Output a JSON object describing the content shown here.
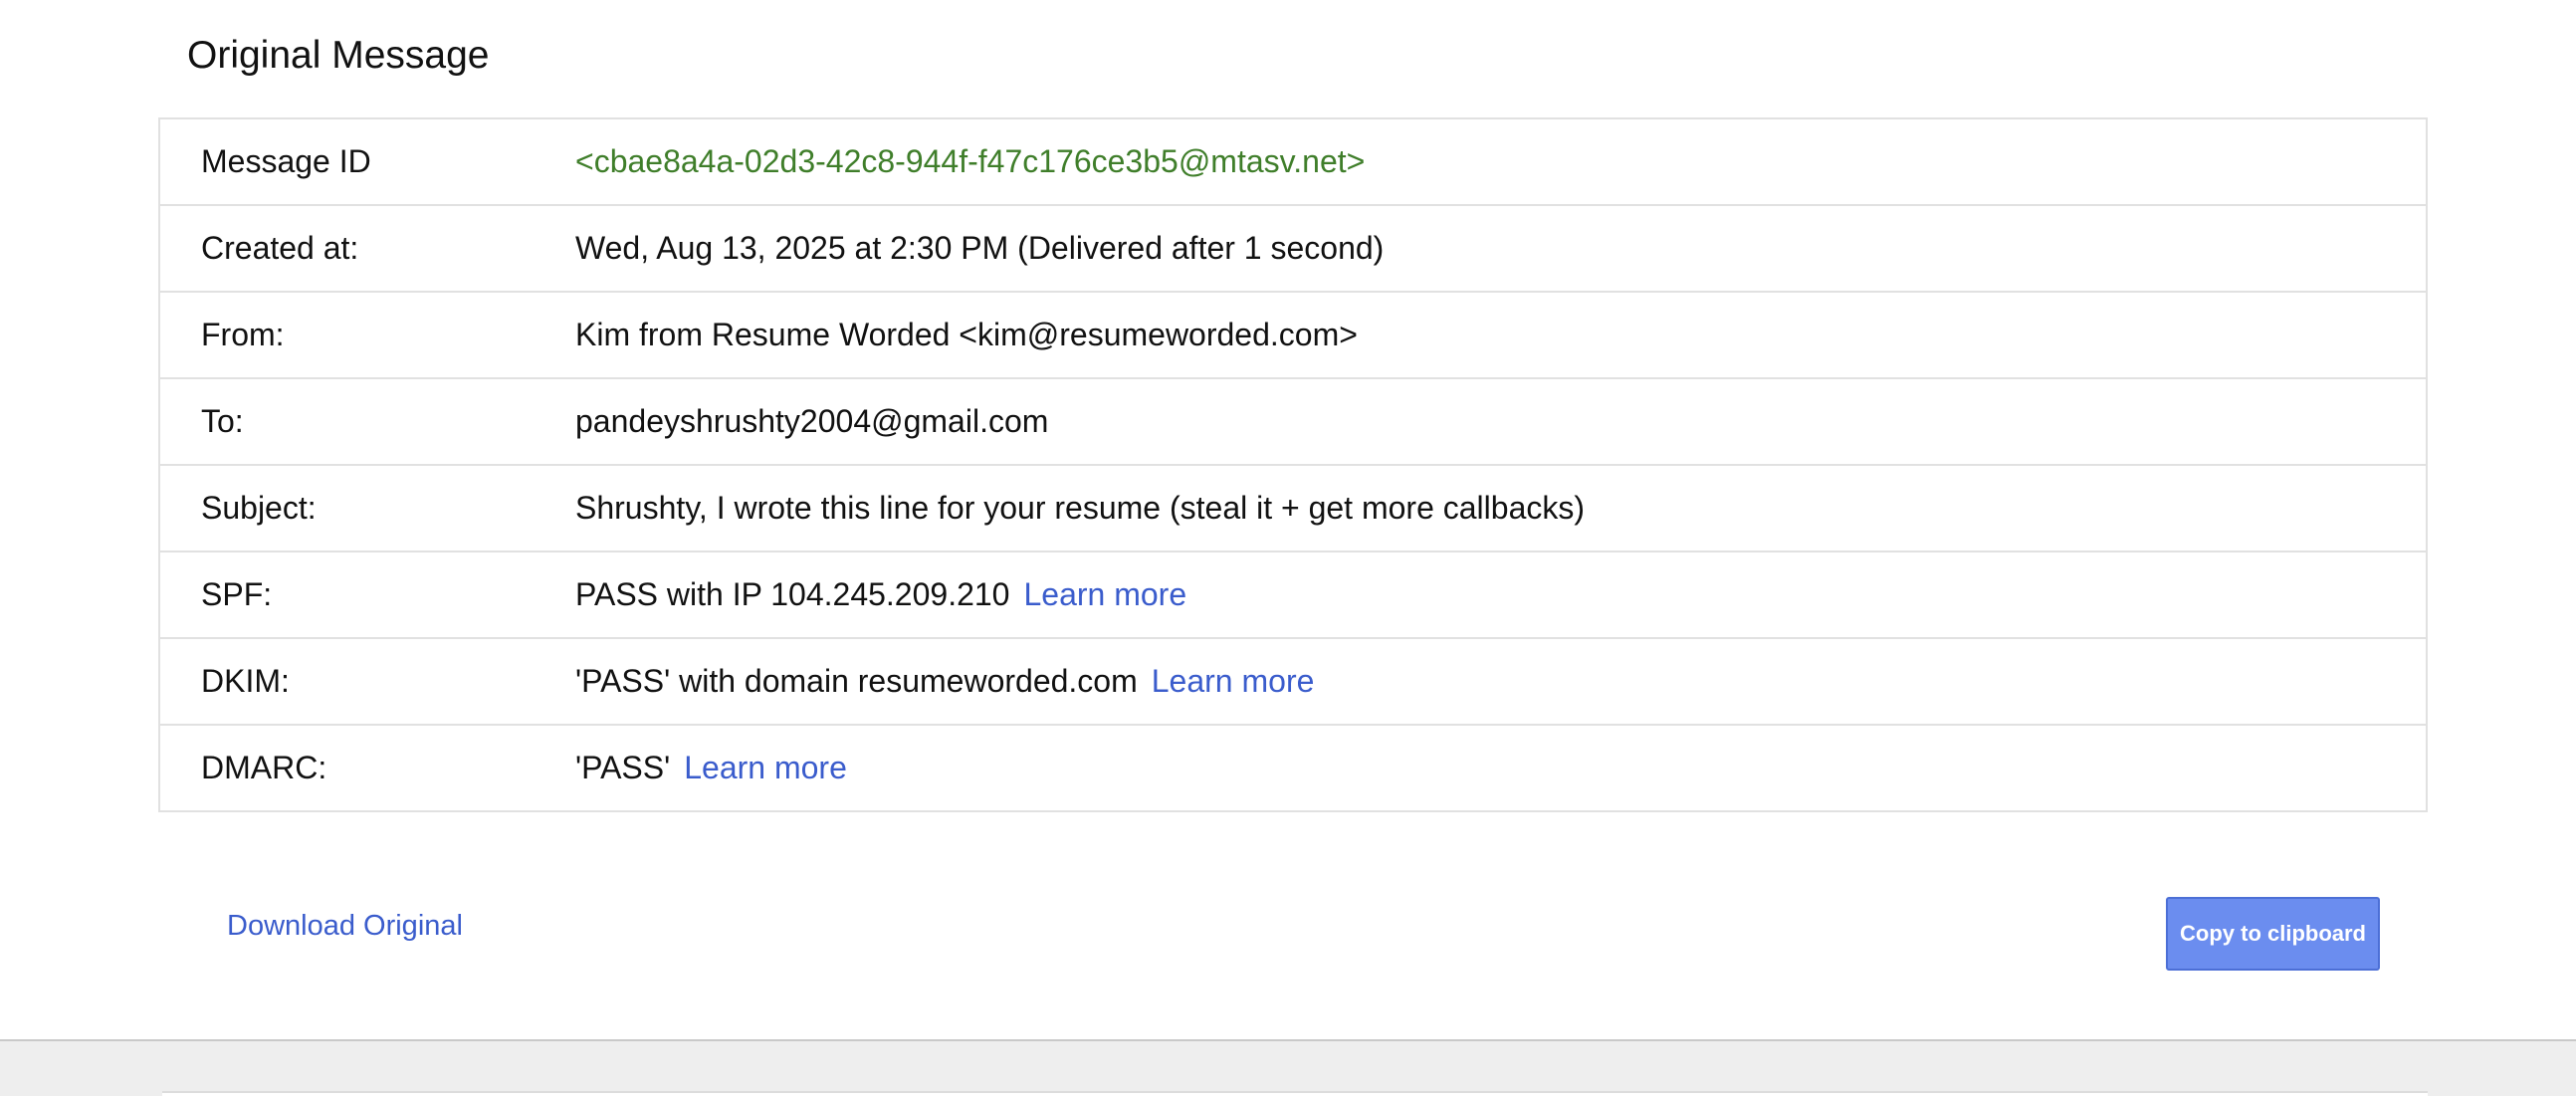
{
  "page": {
    "title": "Original Message"
  },
  "rows": [
    {
      "label": "Message ID",
      "value": "<cbae8a4a-02d3-42c8-944f-f47c176ce3b5@mtasv.net>"
    },
    {
      "label": "Created at:",
      "value": "Wed, Aug 13, 2025 at 2:30 PM (Delivered after 1 second)"
    },
    {
      "label": "From:",
      "value": "Kim from Resume Worded <kim@resumeworded.com>"
    },
    {
      "label": "To:",
      "value": "pandeyshrushty2004@gmail.com"
    },
    {
      "label": "Subject:",
      "value": "Shrushty, I wrote this line for your resume (steal it + get more callbacks)"
    },
    {
      "label": "SPF:",
      "value": "PASS with IP 104.245.209.210",
      "link": "Learn more"
    },
    {
      "label": "DKIM:",
      "value": "'PASS' with domain resumeworded.com",
      "link": "Learn more"
    },
    {
      "label": "DMARC:",
      "value": "'PASS'",
      "link": "Learn more"
    }
  ],
  "actions": {
    "download_label": "Download Original",
    "copy_label": "Copy to clipboard"
  },
  "colors": {
    "link": "#3a5ccc",
    "message_id": "#3f7e2a",
    "button": "#6b8def"
  }
}
